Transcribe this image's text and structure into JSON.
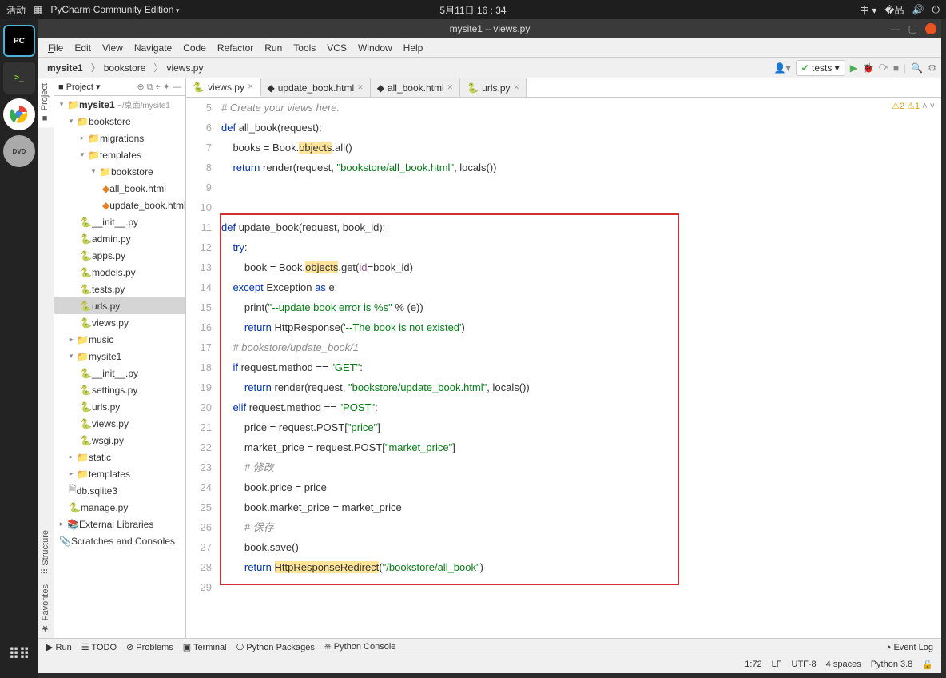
{
  "sys": {
    "activities": "活动",
    "app_name": "PyCharm Community Edition",
    "clock": "5月11日  16 : 34",
    "ime": "中 ▾"
  },
  "window": {
    "title": "mysite1 – views.py"
  },
  "menu": {
    "file": "File",
    "edit": "Edit",
    "view": "View",
    "navigate": "Navigate",
    "code": "Code",
    "refactor": "Refactor",
    "run": "Run",
    "tools": "Tools",
    "vcs": "VCS",
    "window": "Window",
    "help": "Help"
  },
  "breadcrumb": {
    "a": "mysite1",
    "b": "bookstore",
    "c": "views.py"
  },
  "toolbar": {
    "config": "tests",
    "run_icon": "▶",
    "bug_icon": "🐞"
  },
  "project": {
    "title": "Project",
    "root": "mysite1",
    "root_hint": "~/桌面/mysite1",
    "bookstore": "bookstore",
    "migrations": "migrations",
    "templates": "templates",
    "bookstore2": "bookstore",
    "all_book": "all_book.html",
    "update_book": "update_book.html",
    "init": "__init__.py",
    "admin": "admin.py",
    "apps": "apps.py",
    "models": "models.py",
    "tests": "tests.py",
    "urls": "urls.py",
    "views": "views.py",
    "music": "music",
    "mysite1": "mysite1",
    "init2": "__init__.py",
    "settings": "settings.py",
    "urls2": "urls.py",
    "views2": "views.py",
    "wsgi": "wsgi.py",
    "static": "static",
    "templates2": "templates",
    "db": "db.sqlite3",
    "manage": "manage.py",
    "ext": "External Libraries",
    "scratches": "Scratches and Consoles"
  },
  "tabs": {
    "views": "views.py",
    "update": "update_book.html",
    "allbook": "all_book.html",
    "urls": "urls.py"
  },
  "editor_status": {
    "warnings": "⚠2",
    "hints": "⚠1"
  },
  "code": {
    "lines_start": 5,
    "lines": [
      {
        "n": 5,
        "html": "<span class='cm'># Create your views here.</span>"
      },
      {
        "n": 6,
        "html": "<span class='kw'>def </span>all_book(request):"
      },
      {
        "n": 7,
        "html": "    books = Book.<span class='hl'>objects</span>.all()"
      },
      {
        "n": 8,
        "html": "    <span class='kw'>return</span> render(request, <span class='st'>\"bookstore/all_book.html\"</span>, locals())"
      },
      {
        "n": 9,
        "html": ""
      },
      {
        "n": 10,
        "html": ""
      },
      {
        "n": 11,
        "html": "<span class='kw'>def </span>update_book(request, book_id):"
      },
      {
        "n": 12,
        "html": "    <span class='kw'>try</span>:"
      },
      {
        "n": 13,
        "html": "        book = Book.<span class='hl'>objects</span>.get(<span class='self'>id</span>=book_id)"
      },
      {
        "n": 14,
        "html": "    <span class='kw'>except</span> Exception <span class='kw'>as</span> e:"
      },
      {
        "n": 15,
        "html": "        print(<span class='st'>\"--update book error is %s\"</span> % (e))"
      },
      {
        "n": 16,
        "html": "        <span class='kw'>return</span> HttpResponse(<span class='st'>'--The book is not existed'</span>)"
      },
      {
        "n": 17,
        "html": "    <span class='cm'># bookstore/update_book/1</span>"
      },
      {
        "n": 18,
        "html": "    <span class='kw'>if</span> request.method == <span class='st'>\"GET\"</span>:"
      },
      {
        "n": 19,
        "html": "        <span class='kw'>return</span> render(request, <span class='st'>\"bookstore/update_book.html\"</span>, locals())"
      },
      {
        "n": 20,
        "html": "    <span class='kw'>elif</span> request.method == <span class='st'>\"POST\"</span>:"
      },
      {
        "n": 21,
        "html": "        price = request.POST[<span class='st'>\"price\"</span>]"
      },
      {
        "n": 22,
        "html": "        market_price = request.POST[<span class='st'>\"market_price\"</span>]"
      },
      {
        "n": 23,
        "html": "        <span class='cm'># 修改</span>"
      },
      {
        "n": 24,
        "html": "        book.price = price"
      },
      {
        "n": 25,
        "html": "        book.market_price = market_price"
      },
      {
        "n": 26,
        "html": "        <span class='cm'># 保存</span>"
      },
      {
        "n": 27,
        "html": "        book.save()"
      },
      {
        "n": 28,
        "html": "        <span class='kw'>return</span> <span class='hl'>HttpResponseRedirect</span>(<span class='st'>\"/bookstore/all_book\"</span>)"
      },
      {
        "n": 29,
        "html": ""
      }
    ]
  },
  "bottom": {
    "run": "Run",
    "todo": "TODO",
    "problems": "Problems",
    "terminal": "Terminal",
    "pypkg": "Python Packages",
    "pyconsole": "Python Console",
    "eventlog": "Event Log"
  },
  "status": {
    "cursor": "1:72",
    "sep": "LF",
    "enc": "UTF-8",
    "indent": "4 spaces",
    "sdk": "Python 3.8"
  },
  "sidebar_tabs": {
    "project": "Project",
    "structure": "Structure",
    "favorites": "Favorites"
  }
}
